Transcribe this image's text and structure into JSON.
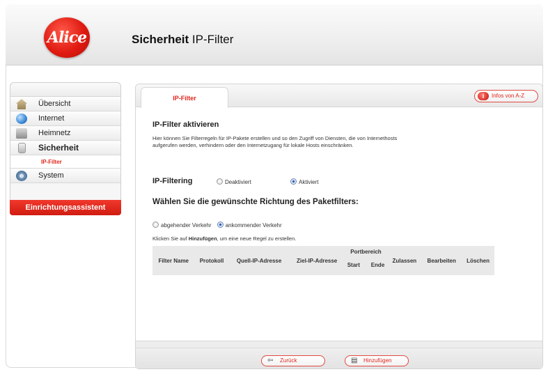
{
  "header": {
    "logo_text": "Alice",
    "title_bold": "Sicherheit",
    "title_rest": " IP-Filter"
  },
  "sidebar": {
    "items": [
      {
        "label": "Übersicht",
        "icon": "home-icon"
      },
      {
        "label": "Internet",
        "icon": "globe-icon"
      },
      {
        "label": "Heimnetz",
        "icon": "network-icon"
      },
      {
        "label": "Sicherheit",
        "icon": "lock-icon",
        "active": true
      },
      {
        "label": "System",
        "icon": "gear-icon"
      }
    ],
    "subitem": "IP-Filter",
    "wizard_label": "Einrichtungsassistent"
  },
  "panel": {
    "tab_label": "IP-Filter",
    "info_button": "Infos von A-Z",
    "section_title": "IP-Filter aktivieren",
    "description": "Hier können Sie Filterregeln für IP-Pakete erstellen und so den Zugriff von Diensten, die von Internethosts aufgerufen werden, verhindern oder den Internetzugang für lokale Hosts einschränken.",
    "filtering": {
      "label": "IP-Filtering",
      "options": [
        "Deaktiviert",
        "Aktiviert"
      ],
      "selected": "Aktiviert"
    },
    "direction_title": "Wählen Sie die gewünschte Richtung des Paketfilters:",
    "direction": {
      "options": [
        "abgehender Verkehr",
        "ankommender Verkehr"
      ],
      "selected": "ankommender Verkehr"
    },
    "hint_prefix": "Klicken Sie auf ",
    "hint_bold": "Hinzufügen",
    "hint_suffix": ", um eine neue Regel zu erstellen.",
    "table": {
      "columns": [
        "Filter Name",
        "Protokoll",
        "Quell-IP-Adresse",
        "Ziel-IP-Adresse",
        "Portbereich",
        "Zulassen",
        "Bearbeiten",
        "Löschen"
      ],
      "port_sub": [
        "Start",
        "Ende"
      ],
      "rows": []
    },
    "buttons": {
      "back": "Zurück",
      "add": "Hinzufügen"
    }
  },
  "colors": {
    "brand_red": "#e0261c"
  }
}
